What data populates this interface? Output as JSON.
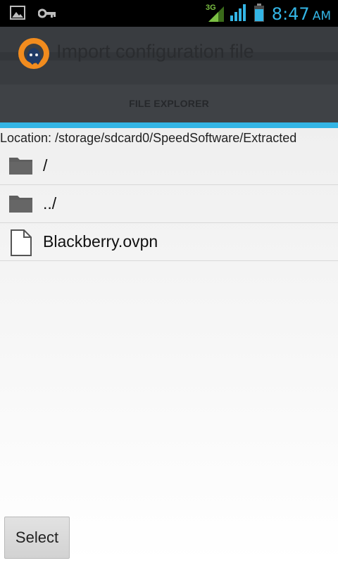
{
  "status_bar": {
    "icons": [
      "image-icon",
      "vpn-key-icon",
      "signal-3g-icon",
      "signal-icon",
      "battery-icon"
    ],
    "network_label": "3G",
    "time": "8:47",
    "ampm": "AM",
    "accent_color": "#33b5e5"
  },
  "action_bar": {
    "title": "Import configuration file"
  },
  "tabs": [
    {
      "label": "FILE EXPLORER",
      "selected": true
    }
  ],
  "location": "Location: /storage/sdcard0/SpeedSoftware/Extracted",
  "files": [
    {
      "name": "/",
      "icon": "folder-icon"
    },
    {
      "name": "../",
      "icon": "folder-icon"
    },
    {
      "name": "Blackberry.ovpn",
      "icon": "file-icon"
    }
  ],
  "buttons": {
    "select": "Select"
  }
}
